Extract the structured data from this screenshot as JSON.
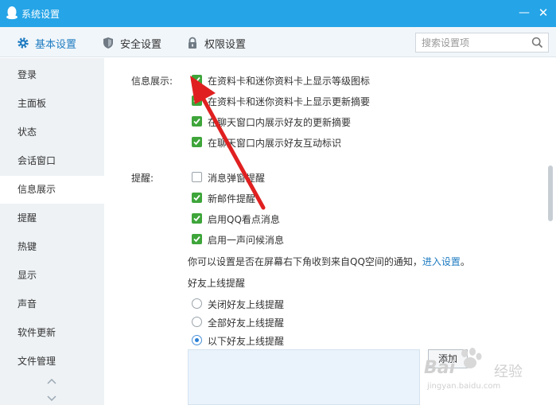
{
  "window": {
    "title": "系统设置",
    "minimize_icon": "minimize-icon",
    "close_icon": "close-icon"
  },
  "toolbar": {
    "tabs": [
      {
        "label": "基本设置",
        "icon": "gear-icon",
        "active": true
      },
      {
        "label": "安全设置",
        "icon": "shield-icon",
        "active": false
      },
      {
        "label": "权限设置",
        "icon": "lock-icon",
        "active": false
      }
    ],
    "search_placeholder": "搜索设置项"
  },
  "sidebar": {
    "items": [
      {
        "label": "登录"
      },
      {
        "label": "主面板"
      },
      {
        "label": "状态"
      },
      {
        "label": "会话窗口"
      },
      {
        "label": "信息展示",
        "active": true
      },
      {
        "label": "提醒"
      },
      {
        "label": "热键"
      },
      {
        "label": "显示"
      },
      {
        "label": "声音"
      },
      {
        "label": "软件更新"
      },
      {
        "label": "文件管理"
      }
    ]
  },
  "info_display": {
    "label": "信息展示:",
    "options": [
      {
        "label": "在资料卡和迷你资料卡上显示等级图标",
        "checked": true
      },
      {
        "label": "在资料卡和迷你资料卡上显示更新摘要",
        "checked": true
      },
      {
        "label": "在聊天窗口内展示好友的更新摘要",
        "checked": true
      },
      {
        "label": "在聊天窗口内展示好友互动标识",
        "checked": true
      }
    ]
  },
  "reminder": {
    "label": "提醒:",
    "options": [
      {
        "label": "消息弹窗提醒",
        "checked": false
      },
      {
        "label": "新邮件提醒",
        "checked": true
      },
      {
        "label": "启用QQ看点消息",
        "checked": true
      },
      {
        "label": "启用一声问候消息",
        "checked": true
      }
    ],
    "note": "你可以设置是否在屏幕右下角收到来自QQ空间的通知，",
    "note_link": "进入设置",
    "note_end": "。",
    "friend_online_title": "好友上线提醒",
    "friend_online_options": [
      {
        "label": "关闭好友上线提醒",
        "selected": false
      },
      {
        "label": "全部好友上线提醒",
        "selected": false
      },
      {
        "label": "以下好友上线提醒",
        "selected": true
      }
    ],
    "add_button": "添加"
  },
  "colors": {
    "titlebar": "#25a4e7",
    "accent": "#1f7cc1",
    "checkbox_on": "#3ea53a",
    "annotation_arrow": "#e02020"
  },
  "watermark": {
    "line1": "Bai",
    "line1_cn": "经验",
    "line2": "jingyan.baidu.com"
  }
}
